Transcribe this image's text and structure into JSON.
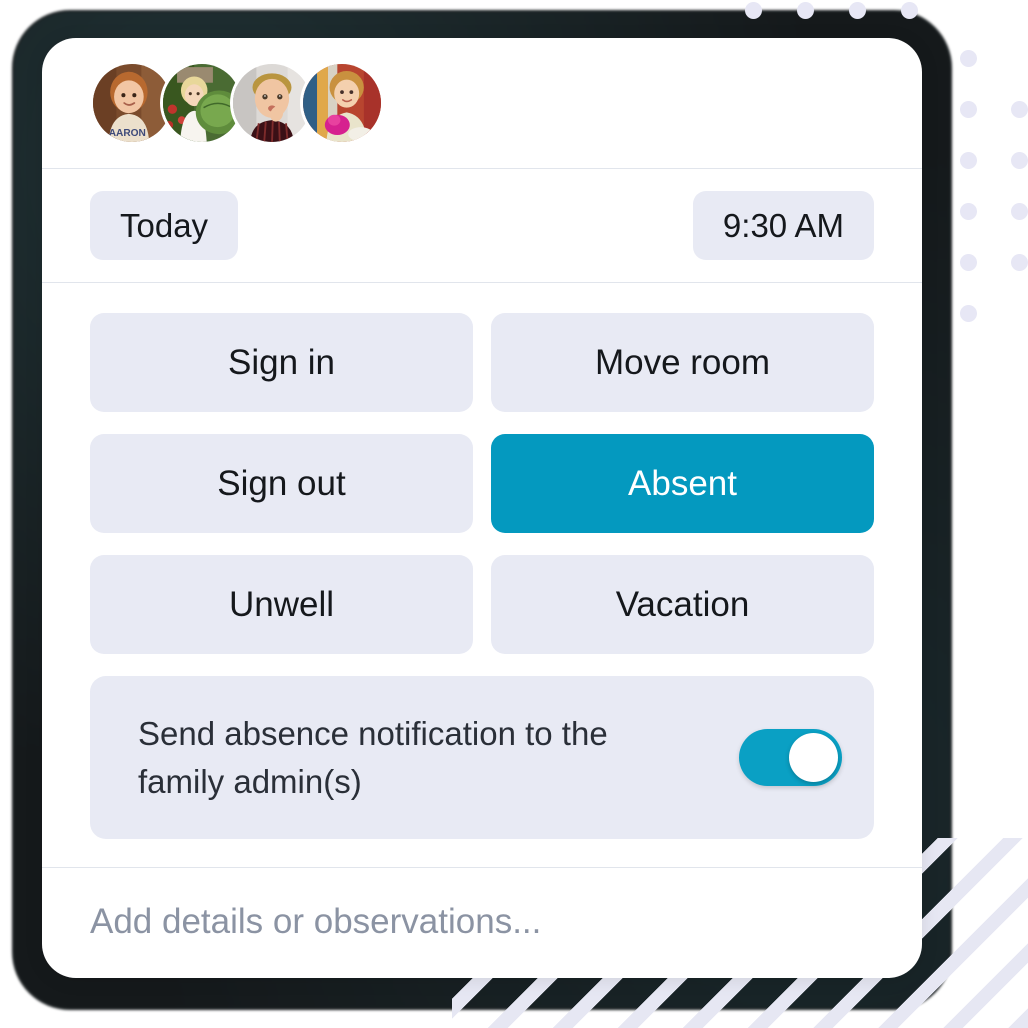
{
  "app": {
    "accent_color": "#0499bf",
    "surface_color": "#e8eaf4",
    "card_color": "#ffffff"
  },
  "avatars": [
    {
      "name": "child-avatar-1",
      "alt": "Toddler in cream AARON shirt",
      "shirt_text": "AARON"
    },
    {
      "name": "child-avatar-2",
      "alt": "Blonde girl holding green leaves in garden",
      "shirt_text": ""
    },
    {
      "name": "child-avatar-3",
      "alt": "Boy with hand near mouth in striped shirt",
      "shirt_text": ""
    },
    {
      "name": "child-avatar-4",
      "alt": "Child with curly hair holding pink toy",
      "shirt_text": ""
    }
  ],
  "meta": {
    "date_label": "Today",
    "time_label": "9:30 AM"
  },
  "actions": [
    {
      "id": "sign-in",
      "label": "Sign in",
      "selected": false
    },
    {
      "id": "move-room",
      "label": "Move room",
      "selected": false
    },
    {
      "id": "sign-out",
      "label": "Sign out",
      "selected": false
    },
    {
      "id": "absent",
      "label": "Absent",
      "selected": true
    },
    {
      "id": "unwell",
      "label": "Unwell",
      "selected": false
    },
    {
      "id": "vacation",
      "label": "Vacation",
      "selected": false
    }
  ],
  "notify": {
    "label": "Send absence notification to the family admin(s)",
    "enabled": true,
    "state_text": "On"
  },
  "note": {
    "placeholder": "Add details or observations...",
    "value": ""
  },
  "decor": {
    "dot_color": "#e7e7f5",
    "stripe_color": "#e6e7f3",
    "frame_color": "#15191b"
  }
}
